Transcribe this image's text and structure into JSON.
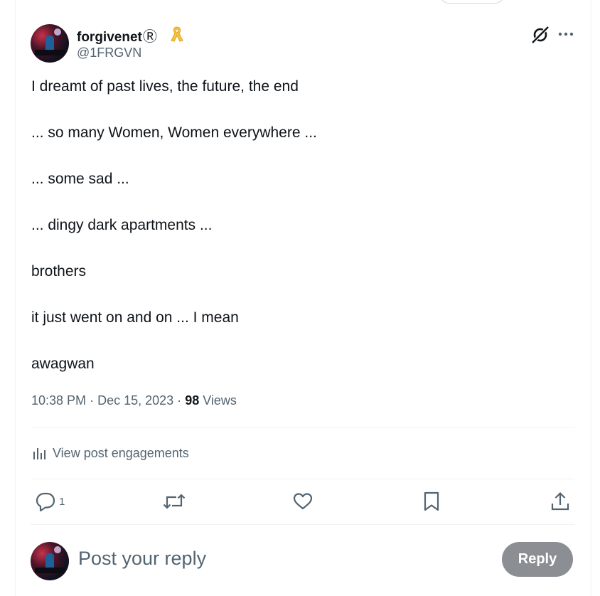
{
  "post": {
    "author": {
      "display_name": "forgivenet",
      "name_symbol": "Ⓡ",
      "badge_icon": "yellow-ribbon-icon",
      "handle": "@1FRGVN"
    },
    "lines": [
      "I dreamt of past lives, the future, the end",
      "... so many Women, Women everywhere ...",
      "... some sad ...",
      "... dingy dark apartments ...",
      "brothers",
      "it just went on and on ... I mean",
      "awagwan"
    ],
    "time": "10:38 PM",
    "separator": "·",
    "date": "Dec 15, 2023",
    "views_count": "98",
    "views_label": "Views"
  },
  "engagements": {
    "label": "View post engagements"
  },
  "actions": {
    "reply": {
      "icon": "reply-icon",
      "count": "1"
    },
    "repost": {
      "icon": "repost-icon"
    },
    "like": {
      "icon": "heart-icon"
    },
    "bookmark": {
      "icon": "bookmark-icon"
    },
    "share": {
      "icon": "share-icon"
    }
  },
  "reply_box": {
    "placeholder": "Post your reply",
    "button_label": "Reply"
  },
  "colors": {
    "text": "#0f1419",
    "secondary": "#536471",
    "divider": "#eff3f4",
    "reply_button_disabled": "#8b8f93",
    "ribbon": "#f5c242"
  }
}
